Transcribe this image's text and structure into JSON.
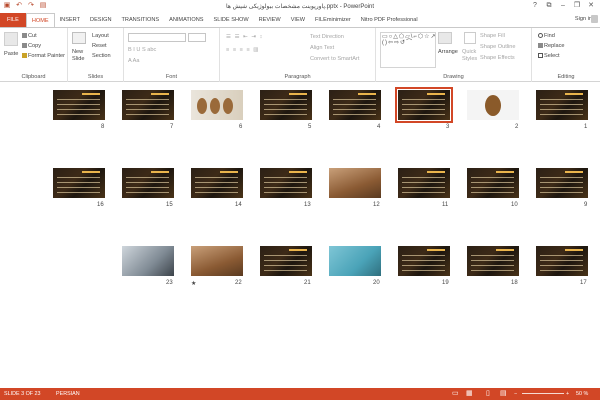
{
  "window": {
    "title": "پاورپوینت مشخصات بیولوژیکی شپش ها.pptx - PowerPoint"
  },
  "qat": {
    "save_icon": "save-icon",
    "undo_icon": "undo-icon",
    "redo_icon": "redo-icon",
    "present_icon": "start-from-beginning-icon"
  },
  "tabs": [
    "FILE",
    "HOME",
    "INSERT",
    "DESIGN",
    "TRANSITIONS",
    "ANIMATIONS",
    "SLIDE SHOW",
    "REVIEW",
    "VIEW",
    "FILEminimizer",
    "Nitro PDF Professional"
  ],
  "active_tab": "HOME",
  "account": {
    "signin": "Sign in"
  },
  "ribbon": {
    "clipboard": {
      "label": "Clipboard",
      "paste": "Paste",
      "cut": "Cut",
      "copy": "Copy",
      "format_painter": "Format Painter"
    },
    "slides": {
      "label": "Slides",
      "new_slide": "New",
      "new_slide2": "Slide",
      "layout": "Layout",
      "reset": "Reset",
      "section": "Section"
    },
    "font": {
      "label": "Font"
    },
    "paragraph": {
      "label": "Paragraph",
      "text_direction": "Text Direction",
      "align_text": "Align Text",
      "convert_smartart": "Convert to SmartArt"
    },
    "drawing": {
      "label": "Drawing",
      "arrange": "Arrange",
      "quick": "Quick",
      "styles": "Styles",
      "shape_fill": "Shape Fill",
      "shape_outline": "Shape Outline",
      "shape_effects": "Shape Effects"
    },
    "editing": {
      "label": "Editing",
      "find": "Find",
      "replace": "Replace",
      "select": "Select"
    }
  },
  "slides": [
    {
      "n": "1",
      "kind": "dark"
    },
    {
      "n": "2",
      "kind": "louse"
    },
    {
      "n": "3",
      "kind": "dark",
      "selected": true
    },
    {
      "n": "4",
      "kind": "dark"
    },
    {
      "n": "5",
      "kind": "dark"
    },
    {
      "n": "6",
      "kind": "photo-tan"
    },
    {
      "n": "7",
      "kind": "dark"
    },
    {
      "n": "8",
      "kind": "dark"
    },
    {
      "n": "9",
      "kind": "dark"
    },
    {
      "n": "10",
      "kind": "dark"
    },
    {
      "n": "11",
      "kind": "dark"
    },
    {
      "n": "12",
      "kind": "wood"
    },
    {
      "n": "13",
      "kind": "dark"
    },
    {
      "n": "14",
      "kind": "dark"
    },
    {
      "n": "15",
      "kind": "dark"
    },
    {
      "n": "16",
      "kind": "dark"
    },
    {
      "n": "17",
      "kind": "dark"
    },
    {
      "n": "18",
      "kind": "dark"
    },
    {
      "n": "19",
      "kind": "dark"
    },
    {
      "n": "20",
      "kind": "cartoon"
    },
    {
      "n": "21",
      "kind": "dark"
    },
    {
      "n": "22",
      "kind": "wood",
      "star": "★"
    },
    {
      "n": "23",
      "kind": "laptop"
    }
  ],
  "status": {
    "slide_count": "SLIDE 3 OF 23",
    "language": "PERSIAN",
    "zoom": "50 %"
  },
  "colors": {
    "accent": "#d24726"
  }
}
